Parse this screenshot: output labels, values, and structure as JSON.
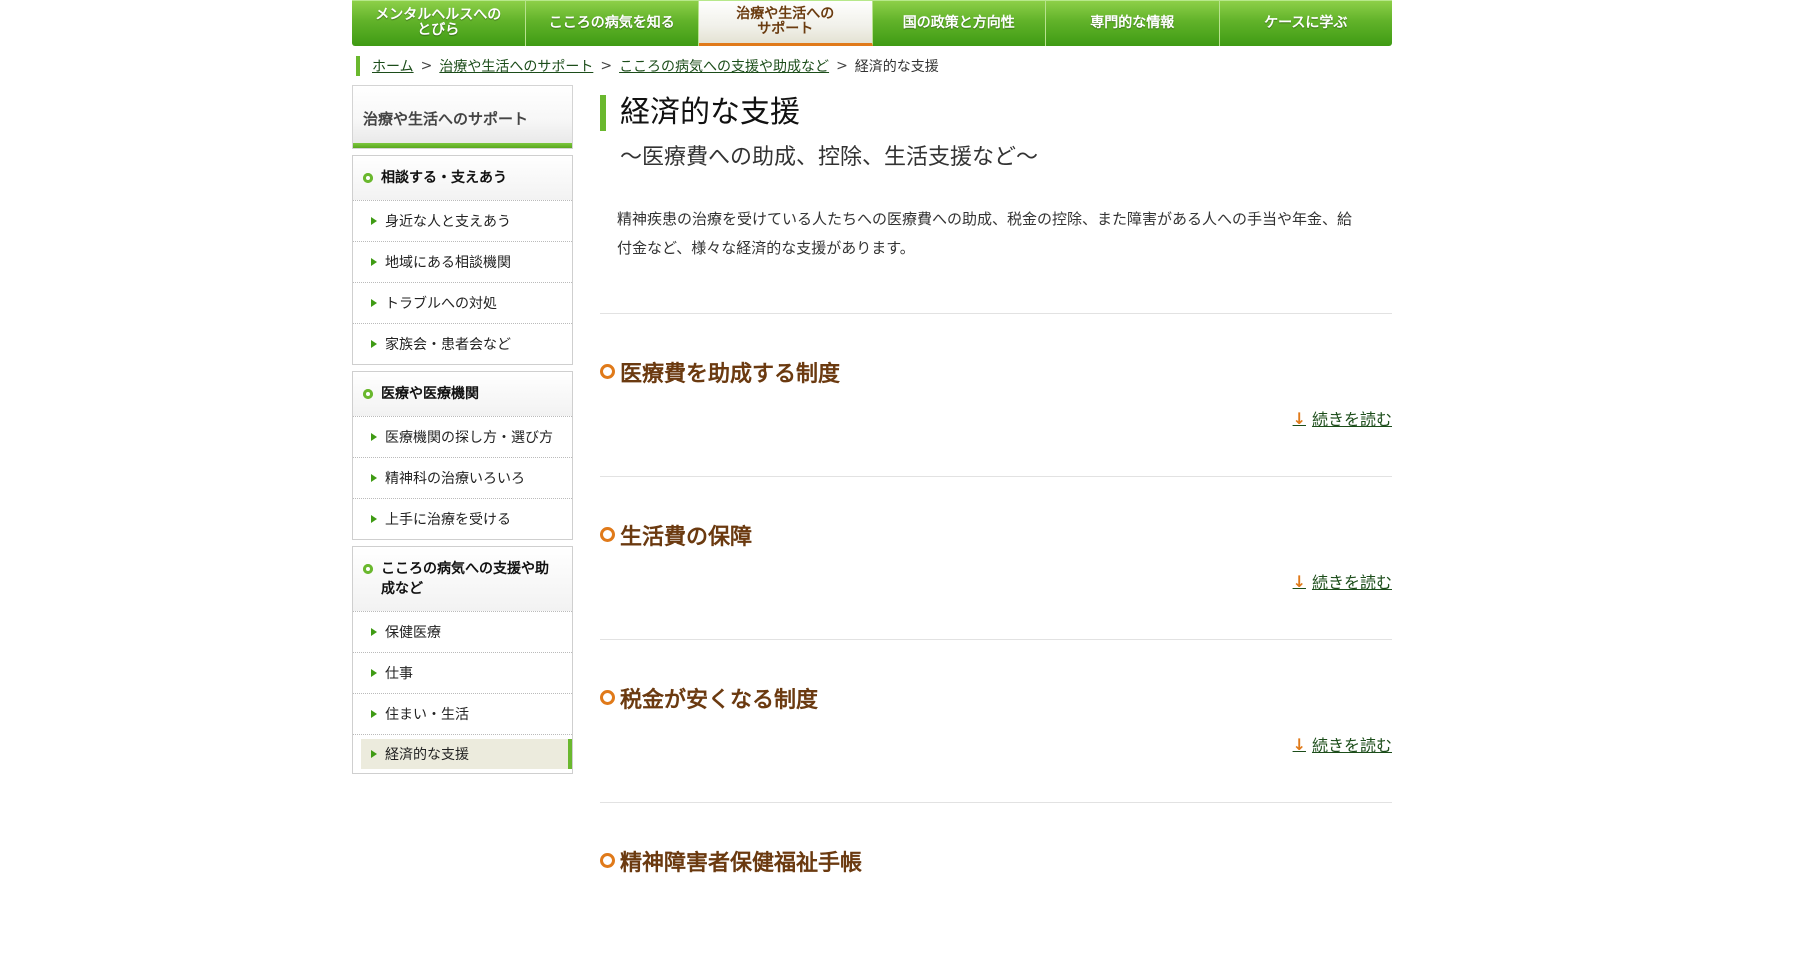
{
  "gnav": {
    "items": [
      {
        "label": "メンタルヘルスへの\nとびら"
      },
      {
        "label": "こころの病気を知る"
      },
      {
        "label": "治療や生活への\nサポート"
      },
      {
        "label": "国の政策と方向性"
      },
      {
        "label": "専門的な情報"
      },
      {
        "label": "ケースに学ぶ"
      }
    ],
    "active_index": 2
  },
  "breadcrumb": {
    "items": [
      "ホーム",
      "治療や生活へのサポート",
      "こころの病気への支援や助成など"
    ],
    "current": "経済的な支援",
    "separator": ">"
  },
  "sidebar": {
    "header": "治療や生活へのサポート",
    "groups": [
      {
        "title": "相談する・支えあう",
        "items": [
          "身近な人と支えあう",
          "地域にある相談機関",
          "トラブルへの対処",
          "家族会・患者会など"
        ]
      },
      {
        "title": "医療や医療機関",
        "items": [
          "医療機関の探し方・選び方",
          "精神科の治療いろいろ",
          "上手に治療を受ける"
        ]
      },
      {
        "title": "こころの病気への支援や助成など",
        "items": [
          "保健医療",
          "仕事",
          "住まい・生活",
          "経済的な支援"
        ]
      }
    ]
  },
  "main": {
    "title": "経済的な支援",
    "subtitle": "～医療費への助成、控除、生活支援など～",
    "intro": "精神疾患の治療を受けている人たちへの医療費への助成、税金の控除、また障害がある人への手当や年金、給付金など、様々な経済的な支援があります。",
    "sections": [
      {
        "title": "医療費を助成する制度",
        "read_more": "続きを読む"
      },
      {
        "title": "生活費の保障",
        "read_more": "続きを読む"
      },
      {
        "title": "税金が安くなる制度",
        "read_more": "続きを読む"
      },
      {
        "title": "精神障害者保健福祉手帳"
      }
    ]
  },
  "colors": {
    "nav_green": "#62b32a",
    "accent_orange": "#e07a1a",
    "section_title_brown": "#6b3a10",
    "link_green": "#1c4d1a"
  }
}
